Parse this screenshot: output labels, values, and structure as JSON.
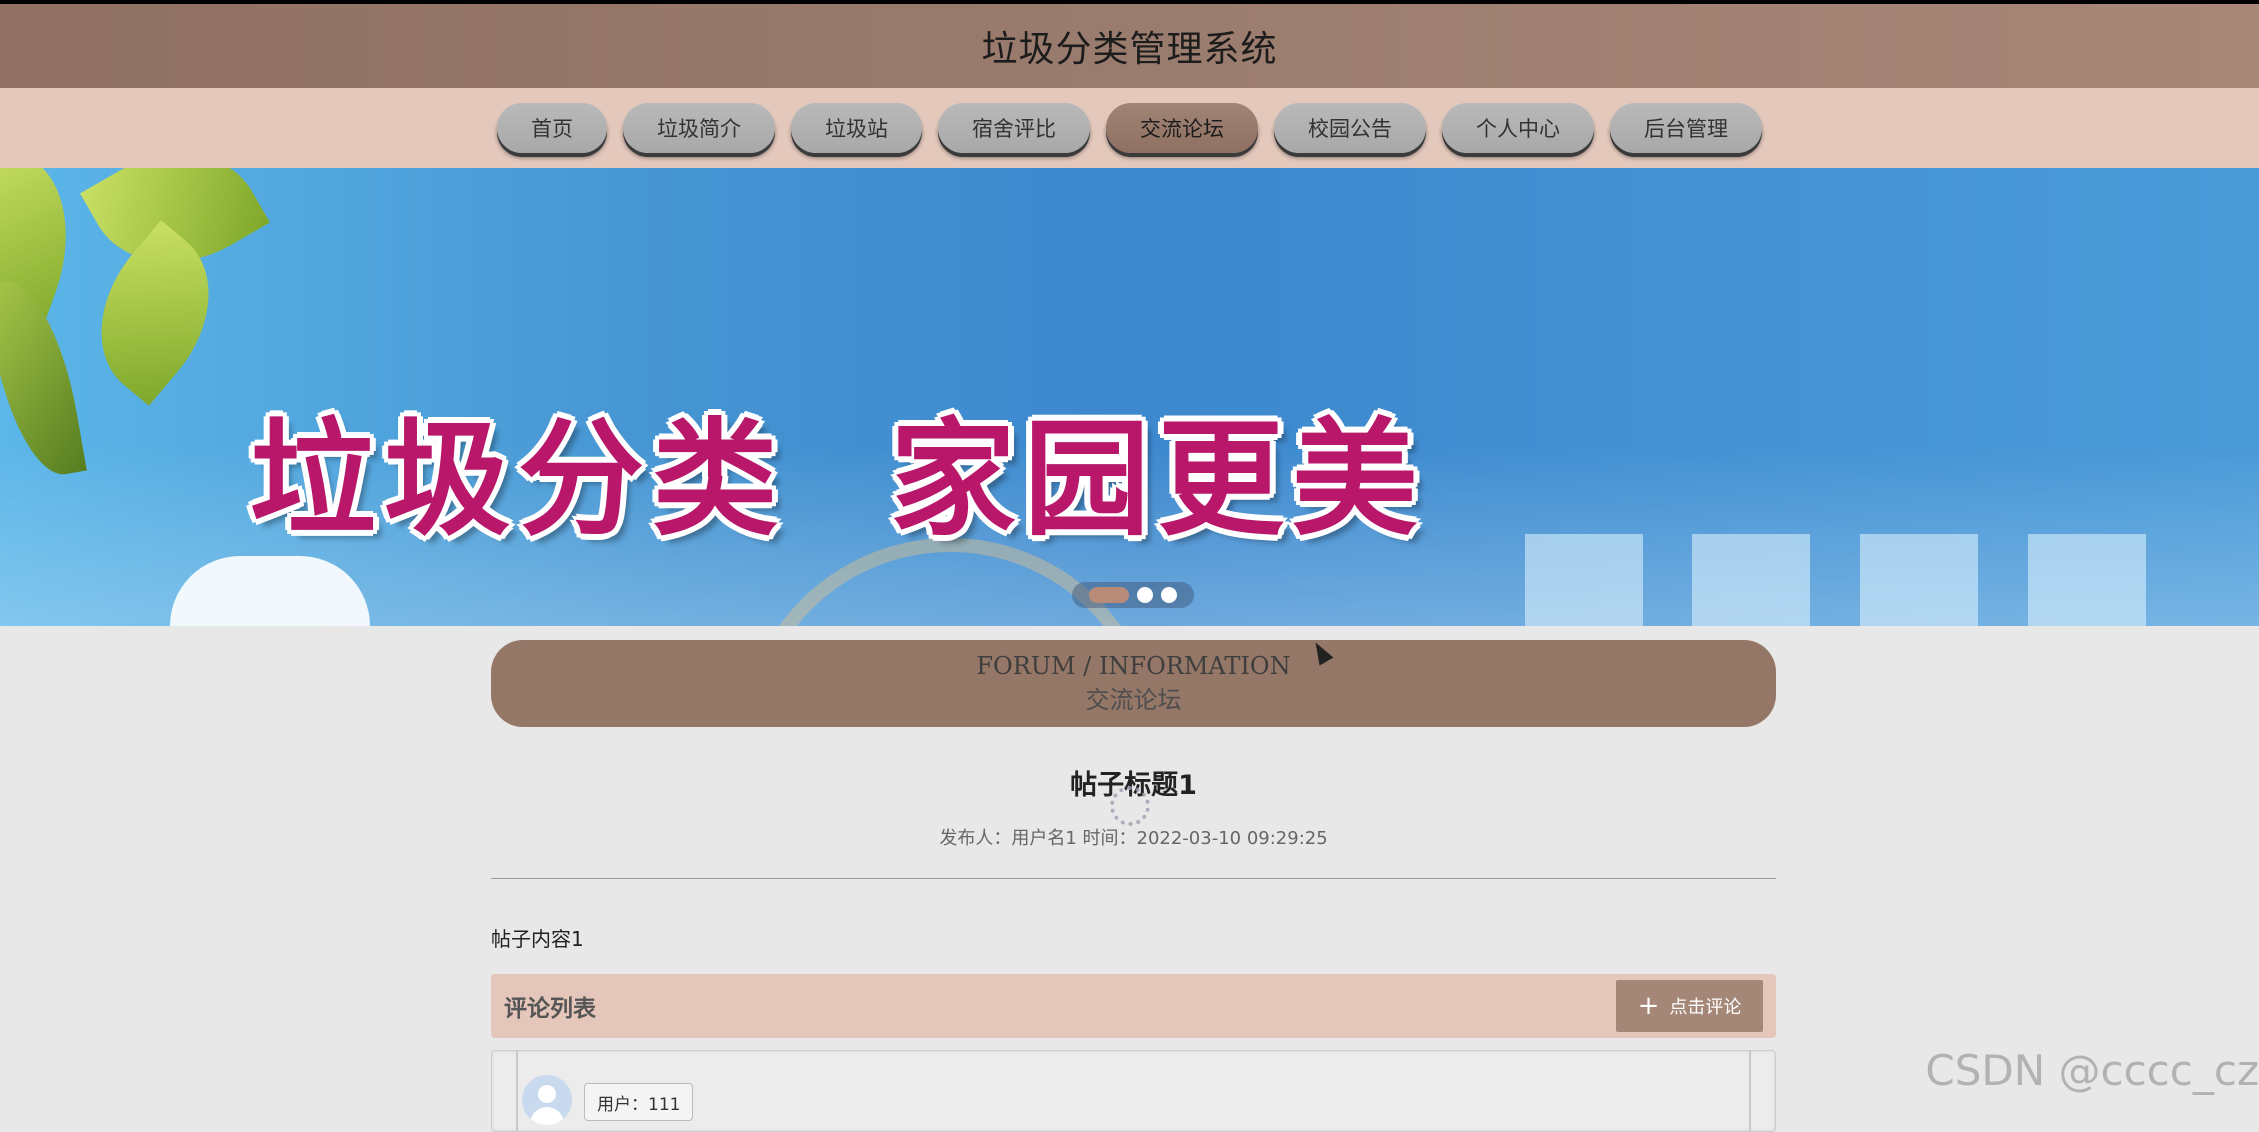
{
  "header": {
    "title": "垃圾分类管理系统"
  },
  "nav": {
    "items": [
      {
        "label": "首页"
      },
      {
        "label": "垃圾简介"
      },
      {
        "label": "垃圾站"
      },
      {
        "label": "宿舍评比"
      },
      {
        "label": "交流论坛",
        "active": true
      },
      {
        "label": "校园公告"
      },
      {
        "label": "个人中心"
      },
      {
        "label": "后台管理"
      }
    ]
  },
  "banner": {
    "slogan": "垃圾分类  家园更美",
    "slides": 3,
    "active_slide": 1
  },
  "section": {
    "title_en": "FORUM / INFORMATION",
    "title_cn": "交流论坛"
  },
  "post": {
    "title": "帖子标题1",
    "meta": "发布人：用户名1 时间：2022-03-10 09:29:25",
    "content": "帖子内容1"
  },
  "comments": {
    "label": "评论列表",
    "button_label": "点击评论",
    "items": [
      {
        "user": "用户：111"
      }
    ]
  },
  "watermark": "CSDN @cccc_cz",
  "colors": {
    "header": "#9a7c6e",
    "nav_bg": "#e4c8bc",
    "active_nav": "#957767",
    "comment_bar": "#e4c6ba",
    "comment_button": "#a58778"
  }
}
